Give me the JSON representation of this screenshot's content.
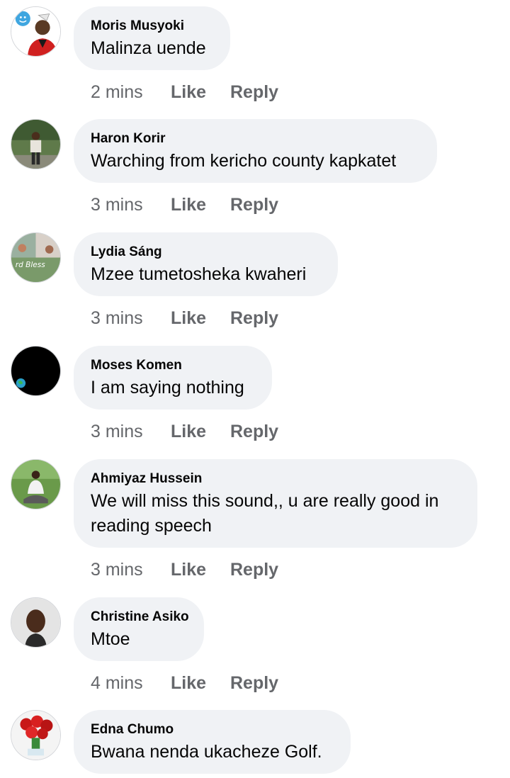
{
  "comments": [
    {
      "author": "Moris Musyoki",
      "text": "Malinza uende",
      "time": "2 mins",
      "avatar": "person-red-shirt-avatar"
    },
    {
      "author": "Haron Korir",
      "text": "Warching from kericho county kapkatet",
      "time": "3 mins",
      "avatar": "person-standing-outdoors-avatar"
    },
    {
      "author": "Lydia Sáng",
      "text": "Mzee tumetosheka kwaheri",
      "time": "3 mins",
      "avatar": "collage-avatar"
    },
    {
      "author": "Moses Komen",
      "text": "I am saying nothing",
      "time": "3 mins",
      "avatar": "black-globe-avatar"
    },
    {
      "author": "Ahmiyaz Hussein",
      "text": "We will miss this sound,, u are really good in reading speech",
      "time": "3 mins",
      "avatar": "person-sitting-grass-avatar"
    },
    {
      "author": "Christine Asiko",
      "text": "Mtoe",
      "time": "4 mins",
      "avatar": "person-selfie-avatar"
    },
    {
      "author": "Edna Chumo",
      "text": "Bwana nenda ukacheze Golf.",
      "time": "",
      "avatar": "red-roses-avatar"
    }
  ],
  "labels": {
    "like": "Like",
    "reply": "Reply"
  },
  "colors": {
    "bubble": "#f0f2f5",
    "secondary_text": "#65676b",
    "primary_text": "#050505"
  }
}
